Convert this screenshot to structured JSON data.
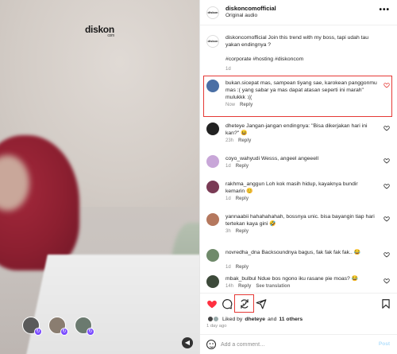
{
  "media": {
    "logo_text": "diskon",
    "logo_sub": "com",
    "collaborators": [
      {
        "name": "collab-1",
        "color": "#5a5a5a"
      },
      {
        "name": "collab-2",
        "color": "#8a7d70"
      },
      {
        "name": "collab-3",
        "color": "#6b7a6f"
      }
    ]
  },
  "header": {
    "avatar_text": "diskon",
    "username": "diskoncomofficial",
    "subtitle": "Original audio",
    "more_label": "•••"
  },
  "caption": {
    "avatar_text": "diskon",
    "text": "diskoncomofficial Join this trend with my boss, tapi udah tau yakan endingnya ?",
    "hashtags": "#corporate #hosting #diskoncom",
    "time": "1d"
  },
  "comments": [
    {
      "text": "bukan.sicepat mas, sampean tiyang sae, karokean panggonmu mas :( yang sabar ya mas dapat atasan seperti ini marah\" mulukkk :((",
      "time": "Now",
      "reply": "Reply",
      "translate": "",
      "avatar_color": "#4a6fa5"
    },
    {
      "text": "dheteye Jangan-jangan endingnya: \"Bisa dikerjakan hari ini kan?\" 😆",
      "time": "23h",
      "reply": "Reply",
      "translate": "",
      "avatar_color": "#222222"
    },
    {
      "text": "coyo_wahyudi Wesss, angeel angeeell",
      "time": "1d",
      "reply": "Reply",
      "translate": "",
      "avatar_color": "#c8a6d8"
    },
    {
      "text": "rakhma_anggun Loh kok masih hidup, kayaknya bundir kemarin 😊",
      "time": "1d",
      "reply": "Reply",
      "translate": "",
      "avatar_color": "#7a3b55"
    },
    {
      "text": "yannaabii hahahahahah, bossnya unic. bisa bayangin tiap hari tertekan kaya gini 🤣",
      "time": "3h",
      "reply": "Reply",
      "translate": "",
      "avatar_color": "#b5785e"
    },
    {
      "text": "novredha_dna Backsoundnya bagus, fak fak fak fak.. 😂",
      "time": "1d",
      "reply": "Reply",
      "translate": "",
      "avatar_color": "#6f8a6a"
    },
    {
      "text": "mbak_bulbul Ndue bos ngono iku rasane pie moas? 😂",
      "time": "14h",
      "reply": "Reply",
      "translate": "See translation",
      "avatar_color": "#3d4a3a"
    }
  ],
  "actions": {
    "liked_prefix": "Liked by",
    "liked_user": "dheteye",
    "liked_and": "and",
    "liked_others": "11 others",
    "time_ago": "1 day ago",
    "like_color": "#ff3040"
  },
  "add_comment": {
    "placeholder": "Add a comment…",
    "post_label": "Post"
  }
}
